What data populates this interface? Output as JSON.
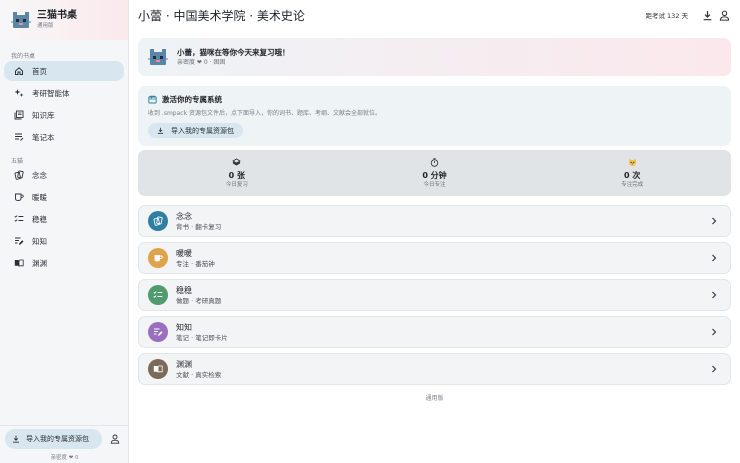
{
  "sidebar": {
    "brand_title": "三猫书桌",
    "brand_subtitle": "通用版",
    "section_mine": "我的书桌",
    "nav_mine": [
      {
        "label": "首页",
        "icon": "home-icon",
        "active": true
      },
      {
        "label": "考研智能体",
        "icon": "sparkle-icon",
        "active": false
      },
      {
        "label": "知识库",
        "icon": "library-icon",
        "active": false
      },
      {
        "label": "笔记本",
        "icon": "notebook-icon",
        "active": false
      }
    ],
    "section_cats": "五猫",
    "nav_cats": [
      {
        "label": "念念",
        "icon": "cards-icon"
      },
      {
        "label": "暖暖",
        "icon": "cup-icon"
      },
      {
        "label": "稳稳",
        "icon": "checklist-icon"
      },
      {
        "label": "知知",
        "icon": "pen-note-icon"
      },
      {
        "label": "渊渊",
        "icon": "book-open-icon"
      }
    ],
    "import_label": "导入我的专属资源包",
    "affinity": "亲密度 ❤ 0"
  },
  "header": {
    "title": "小蕾 · 中国美术学院 · 美术史论",
    "countdown": "距考试 132 天"
  },
  "welcome": {
    "title": "小蕾，猫咪在等你今天来复习哦！",
    "subtitle": "亲密度 ❤ 0 · 困困"
  },
  "activate": {
    "title": "激活你的专属系统",
    "description": "收到 .smpack 资源包文件后，点下面导入，你的词书、题库、考纲、文献会全部就位。",
    "button": "导入我的专属资源包"
  },
  "stats": [
    {
      "value": "0 张",
      "label": "今日复习",
      "icon": "cards-stack-icon"
    },
    {
      "value": "0 分钟",
      "label": "今日专注",
      "icon": "stopwatch-icon"
    },
    {
      "value": "0 次",
      "label": "专注完成",
      "icon": "cat-face-icon"
    }
  ],
  "features": [
    {
      "name": "念念",
      "desc": "背书 · 翻卡复习",
      "color": "#2f7fa0",
      "icon": "cards-icon"
    },
    {
      "name": "暖暖",
      "desc": "专注 · 番茄钟",
      "color": "#e0a24a",
      "icon": "cup-icon"
    },
    {
      "name": "稳稳",
      "desc": "做题 · 考研真题",
      "color": "#4f9b6b",
      "icon": "checklist-icon"
    },
    {
      "name": "知知",
      "desc": "笔记 · 笔记即卡片",
      "color": "#9a6fc0",
      "icon": "pen-note-icon"
    },
    {
      "name": "渊渊",
      "desc": "文献 · 真实检索",
      "color": "#7b6a57",
      "icon": "book-open-icon"
    }
  ],
  "footer_note": "通用版",
  "colors": {
    "accent_bg": "#d7e6ef",
    "sidebar_bg": "#f5f6f7",
    "stats_bg": "#e1e4e7"
  }
}
